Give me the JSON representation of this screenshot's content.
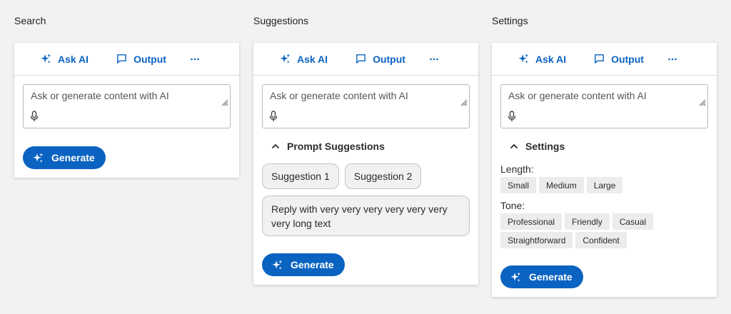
{
  "colors": {
    "accent": "#0b63c1",
    "page_bg": "#f2f2f2",
    "card_bg": "#ffffff",
    "chip_bg": "#ececec"
  },
  "icons": {
    "ask_ai": "sparkle-icon",
    "output": "comment-icon",
    "more": "more-horizontal-icon",
    "mic": "microphone-icon",
    "resize": "resize-grip-icon",
    "collapse": "chevron-up-icon"
  },
  "columns": [
    {
      "title": "Search"
    },
    {
      "title": "Suggestions"
    },
    {
      "title": "Settings"
    }
  ],
  "toolbar": {
    "ask_ai": "Ask AI",
    "output": "Output",
    "more_label": "More"
  },
  "prompt": {
    "placeholder": "Ask or generate content with AI",
    "value": ""
  },
  "generate_label": "Generate",
  "suggestions": {
    "heading": "Prompt Suggestions",
    "items": [
      "Suggestion 1",
      "Suggestion 2",
      "Reply with very very very very very very very long text"
    ]
  },
  "settings": {
    "heading": "Settings",
    "length_label": "Length:",
    "length_options": [
      "Small",
      "Medium",
      "Large"
    ],
    "tone_label": "Tone:",
    "tone_options": [
      "Professional",
      "Friendly",
      "Casual",
      "Straightforward",
      "Confident"
    ]
  }
}
